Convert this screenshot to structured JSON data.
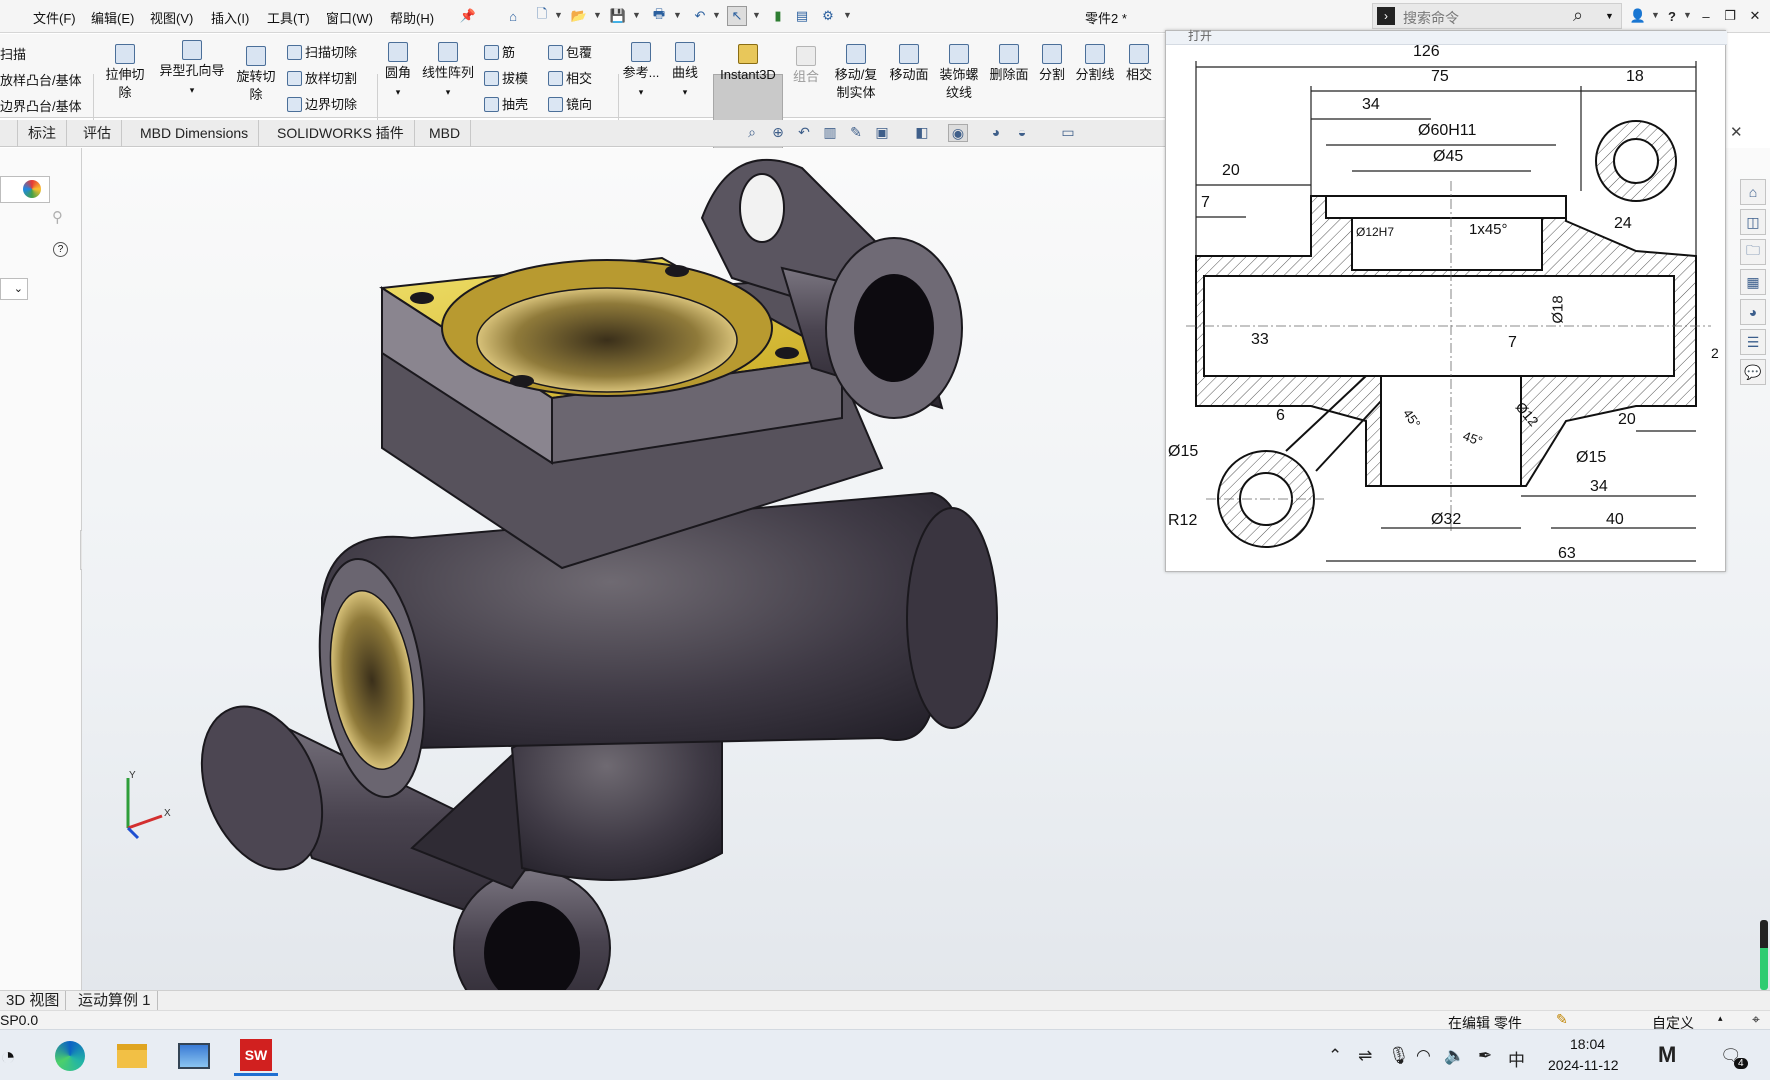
{
  "menu": [
    "文件(F)",
    "编辑(E)",
    "视图(V)",
    "插入(I)",
    "工具(T)",
    "窗口(W)",
    "帮助(H)"
  ],
  "window_title": "零件2 *",
  "search_placeholder": "搜索命令",
  "ribbon": {
    "left_small": [
      "扫描",
      "放样凸台/基体",
      "边界凸台/基体"
    ],
    "cut_extrude": "拉伸切\n除",
    "hole_wizard": "异型孔向导",
    "revolve_cut": "旋转切\n除",
    "cut_small": [
      "扫描切除",
      "放样切割",
      "边界切除"
    ],
    "fillet": "圆角",
    "linear_pattern": "线性阵列",
    "feat_small_a": [
      "筋",
      "拔模",
      "抽壳"
    ],
    "feat_small_b": [
      "包覆",
      "相交",
      "镜向"
    ],
    "reference": "参考...",
    "curves": "曲线",
    "instant3d": "Instant3D",
    "combine": "组合",
    "move_copy": "移动/复\n制实体",
    "move_face": "移动面",
    "cosmetic_thread": "装饰螺\n纹线",
    "delete_face": "删除面",
    "split": "分割",
    "split_line": "分割线",
    "intersect": "相交"
  },
  "tabs": [
    "标注",
    "评估",
    "MBD Dimensions",
    "SOLIDWORKS 插件",
    "MBD"
  ],
  "drawing": {
    "top_label": "打开",
    "dims": [
      "126",
      "75",
      "18",
      "34",
      "Ø60H11",
      "Ø45",
      "20",
      "7",
      "Ø12H7",
      "1x45°",
      "24",
      "33",
      "7",
      "Ø18",
      "2",
      "6",
      "45°",
      "45°",
      "Ø12",
      "20",
      "Ø15",
      "Ø15",
      "34",
      "R12",
      "Ø32",
      "40",
      "63"
    ]
  },
  "bottom_tabs": [
    "3D 视图",
    "运动算例 1"
  ],
  "status": {
    "left": "SP0.0",
    "mode": "在编辑 零件",
    "custom": "自定义"
  },
  "taskbar": {
    "time": "18:04",
    "date": "2024-11-12",
    "ime": "中",
    "notify_count": "4"
  },
  "axes": {
    "x": "X",
    "y": "Y"
  }
}
